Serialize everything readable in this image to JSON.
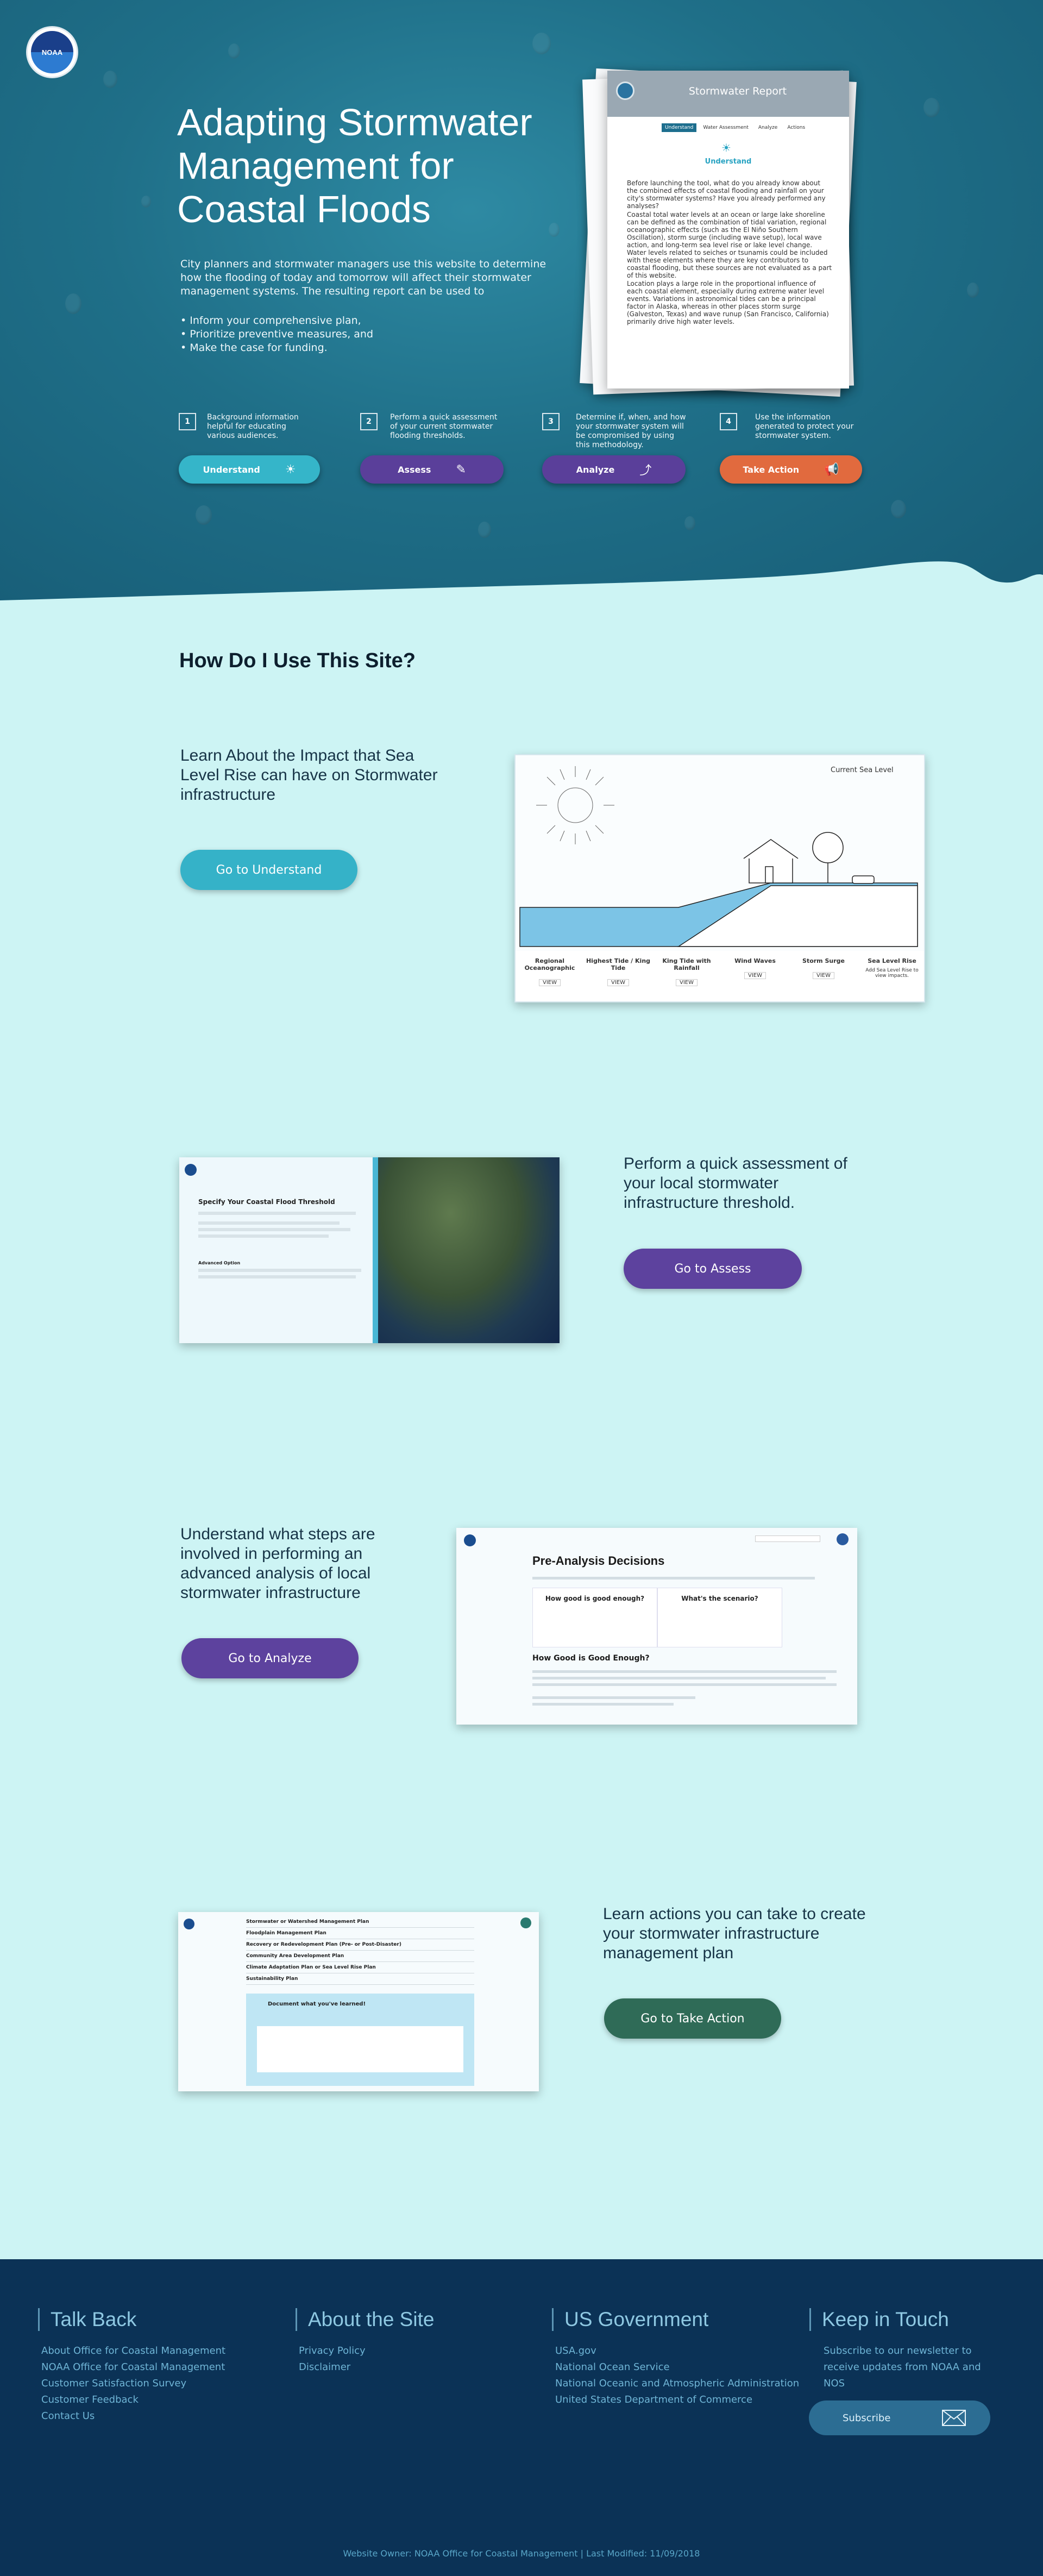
{
  "header": {
    "logo_text": "NOAA"
  },
  "hero": {
    "title": "Adapting Stormwater Management for Coastal Floods",
    "intro": "City planners and stormwater managers use this website to determine how the flooding of today and tomorrow will affect their stormwater management systems. The resulting report can be used to",
    "bullets": [
      "Inform your comprehensive plan,",
      "Prioritize preventive measures, and",
      "Make the case for funding."
    ]
  },
  "report": {
    "title": "Stormwater Report",
    "tabs": [
      "Understand",
      "Water Assessment",
      "Analyze",
      "Actions"
    ],
    "subtitle": "Understand",
    "p1": "Before launching the tool, what do you already know about the combined effects of coastal flooding and rainfall on your city's stormwater systems? Have you already performed any analyses?",
    "p2": "Coastal total water levels at an ocean or large lake shoreline can be defined as the combination of tidal variation, regional oceanographic effects (such as the El Niño Southern Oscillation), storm surge (including wave setup), local wave action, and long-term sea level rise or lake level change. Water levels related to seiches or tsunamis could be included with these elements where they are key contributors to coastal flooding, but these sources are not evaluated as a part of this website.",
    "p3": "Location plays a large role in the proportional influence of each coastal element, especially during extreme water level events. Variations in astronomical tides can be a principal factor in Alaska, whereas in other places storm surge (Galveston, Texas) and wave runup (San Francisco, California) primarily drive high water levels."
  },
  "steps": [
    {
      "num": "1",
      "text": "Background information helpful for educating various audiences.",
      "label": "Understand",
      "icon": "sun-icon",
      "color": "#35b5c9"
    },
    {
      "num": "2",
      "text": "Perform a quick assessment of your current stormwater flooding thresholds.",
      "label": "Assess",
      "icon": "ruler-icon",
      "color": "#5a3f9a"
    },
    {
      "num": "3",
      "text": "Determine if, when, and how your stormwater system will be compromised by using this methodology.",
      "label": "Analyze",
      "icon": "graph-icon",
      "color": "#5a3f9a"
    },
    {
      "num": "4",
      "text": "Use the information generated to protect your stormwater system.",
      "label": "Take Action",
      "icon": "megaphone-icon",
      "color": "#e16a3e"
    }
  ],
  "how": {
    "heading": "How Do I Use This Site?"
  },
  "features": [
    {
      "text": "Learn About the Impact that Sea Level Rise can have on Stormwater infrastructure",
      "button": "Go to Understand",
      "color": "#35b2c8"
    },
    {
      "text": "Perform a quick assessment of your local stormwater infrastructure threshold.",
      "button": "Go to Assess",
      "color": "#5d429e"
    },
    {
      "text": "Understand what steps are involved in performing an advanced analysis of local stormwater infrastructure",
      "button": "Go to Analyze",
      "color": "#5d429e"
    },
    {
      "text": "Learn actions you can take to create your stormwater infrastructure management plan",
      "button": "Go to Take Action",
      "color": "#2f6b57"
    }
  ],
  "shot1": {
    "label": "Current Sea Level",
    "cols": [
      {
        "title": "Regional Oceanographic",
        "btn": "VIEW"
      },
      {
        "title": "Highest Tide / King Tide",
        "btn": "VIEW"
      },
      {
        "title": "King Tide with Rainfall",
        "btn": "VIEW"
      },
      {
        "title": "Wind Waves",
        "btn": "VIEW"
      },
      {
        "title": "Storm Surge",
        "btn": "VIEW"
      },
      {
        "title": "Sea Level Rise",
        "btn": "Add Sea Level Rise to view impacts."
      }
    ]
  },
  "shot2": {
    "heading": "Specify Your Coastal Flood Threshold",
    "section": "Advanced Option"
  },
  "shot3": {
    "title": "Pre-Analysis Decisions",
    "card1": "How good is good enough?",
    "card2": "What's the scenario?",
    "sub": "How Good is Good Enough?"
  },
  "shot4": {
    "rows": [
      "Stormwater or Watershed Management Plan",
      "Floodplain Management Plan",
      "Recovery or Redevelopment Plan (Pre- or Post-Disaster)",
      "Community Area Development Plan",
      "Climate Adaptation Plan or Sea Level Rise Plan",
      "Sustainability Plan"
    ],
    "box_title": "Document what you've learned!"
  },
  "footer": {
    "cols": [
      {
        "heading": "Talk Back",
        "links": [
          "About Office for Coastal Management",
          "NOAA Office for Coastal Management",
          "Customer Satisfaction Survey",
          "Customer Feedback",
          "Contact Us"
        ]
      },
      {
        "heading": "About the Site",
        "links": [
          "Privacy Policy",
          "Disclaimer"
        ]
      },
      {
        "heading": "US Government",
        "links": [
          "USA.gov",
          "National Ocean Service",
          "National Oceanic and Atmospheric Administration",
          "United States Department of Commerce"
        ]
      },
      {
        "heading": "Keep in Touch",
        "links": []
      }
    ],
    "newsletter": "Subscribe to our newsletter to receive updates from NOAA and NOS",
    "subscribe": "Subscribe",
    "copyright": "Website Owner: NOAA Office for Coastal Management | Last Modified: 11/09/2018"
  }
}
